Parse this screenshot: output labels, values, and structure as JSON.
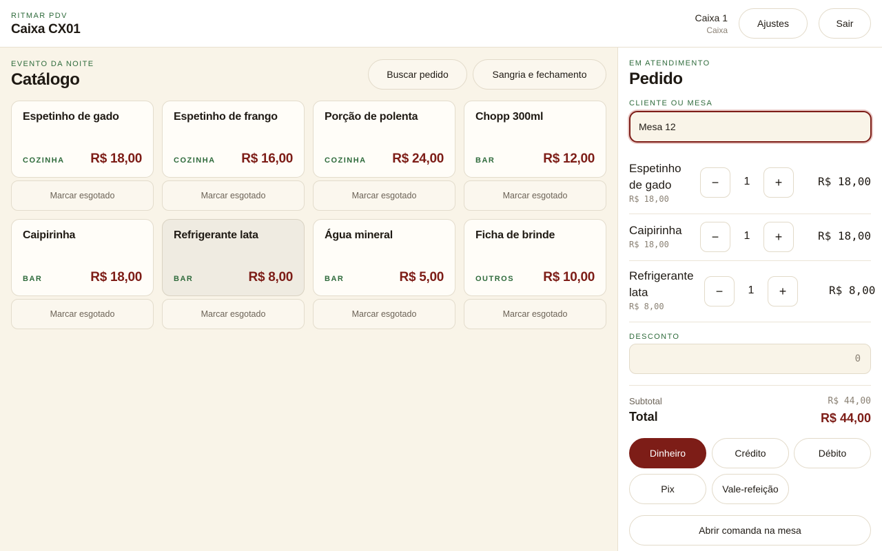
{
  "header": {
    "eyebrow": "RITMAR PDV",
    "title": "Caixa CX01",
    "user_name": "Caixa 1",
    "user_role": "Caixa",
    "settings_label": "Ajustes",
    "logout_label": "Sair"
  },
  "catalog": {
    "eyebrow": "EVENTO DA NOITE",
    "title": "Catálogo",
    "search_order_label": "Buscar pedido",
    "cashout_label": "Sangria e fechamento",
    "soldout_label": "Marcar esgotado",
    "items": [
      {
        "name": "Espetinho de gado",
        "category": "COZINHA",
        "price": "R$ 18,00"
      },
      {
        "name": "Espetinho de frango",
        "category": "COZINHA",
        "price": "R$ 16,00"
      },
      {
        "name": "Porção de polenta",
        "category": "COZINHA",
        "price": "R$ 24,00"
      },
      {
        "name": "Chopp 300ml",
        "category": "BAR",
        "price": "R$ 12,00"
      },
      {
        "name": "Caipirinha",
        "category": "BAR",
        "price": "R$ 18,00"
      },
      {
        "name": "Refrigerante lata",
        "category": "BAR",
        "price": "R$ 8,00"
      },
      {
        "name": "Água mineral",
        "category": "BAR",
        "price": "R$ 5,00"
      },
      {
        "name": "Ficha de brinde",
        "category": "OUTROS",
        "price": "R$ 10,00"
      }
    ]
  },
  "order": {
    "eyebrow": "EM ATENDIMENTO",
    "title": "Pedido",
    "client_label": "CLIENTE OU MESA",
    "client_value": "Mesa 12",
    "lines": [
      {
        "name_1": "Espetinho",
        "name_2": "de gado",
        "unit": "R$ 18,00",
        "qty": "1",
        "total": "R$ 18,00"
      },
      {
        "name_1": "Caipirinha",
        "name_2": "",
        "unit": "R$ 18,00",
        "qty": "1",
        "total": "R$ 18,00"
      },
      {
        "name_1": "Refrigerante",
        "name_2": "lata",
        "unit": "R$ 8,00",
        "qty": "1",
        "total": "R$ 8,00"
      }
    ],
    "minus": "−",
    "plus": "+",
    "discount_label": "DESCONTO",
    "discount_value": "0",
    "subtotal_label": "Subtotal",
    "subtotal_value": "R$ 44,00",
    "total_label": "Total",
    "total_value": "R$ 44,00",
    "payment_methods": [
      "Dinheiro",
      "Crédito",
      "Débito",
      "Pix",
      "Vale-refeição"
    ],
    "selected_payment": "Dinheiro",
    "open_tab_label": "Abrir comanda na mesa"
  },
  "colors": {
    "accent": "#7d1d17",
    "category_green": "#2f6b3c",
    "background": "#f9f4e8"
  }
}
